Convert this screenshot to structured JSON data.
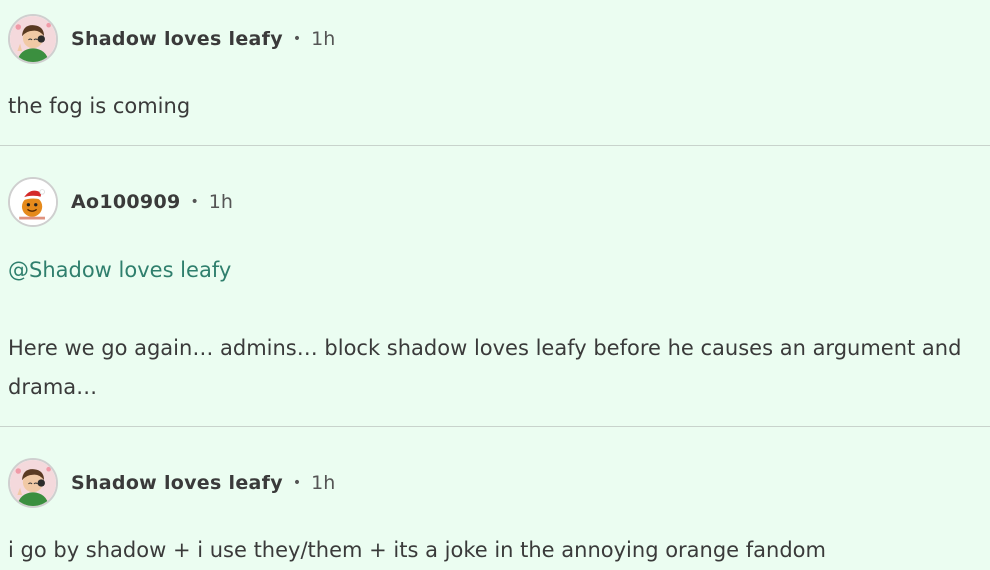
{
  "posts": [
    {
      "username": "Shadow loves leafy",
      "separator": "•",
      "time": "1h",
      "body": "the fog is coming",
      "avatar_icon": "cartoon-boy-avatar-icon"
    },
    {
      "username": "Ao100909",
      "separator": "•",
      "time": "1h",
      "mention": "@Shadow loves leafy",
      "body_line1": "Here we go again… admins… block shadow loves leafy before he causes an argument and",
      "body_line2": "drama…",
      "avatar_icon": "orange-santa-hat-avatar-icon"
    },
    {
      "username": "Shadow loves leafy",
      "separator": "•",
      "time": "1h",
      "body": "i go by shadow + i use they/them + its a joke in the annoying orange fandom",
      "avatar_icon": "cartoon-boy-avatar-icon"
    }
  ],
  "colors": {
    "background": "#ebfdf1",
    "mention": "#2f7f6d",
    "divider": "#c8d3cc"
  }
}
